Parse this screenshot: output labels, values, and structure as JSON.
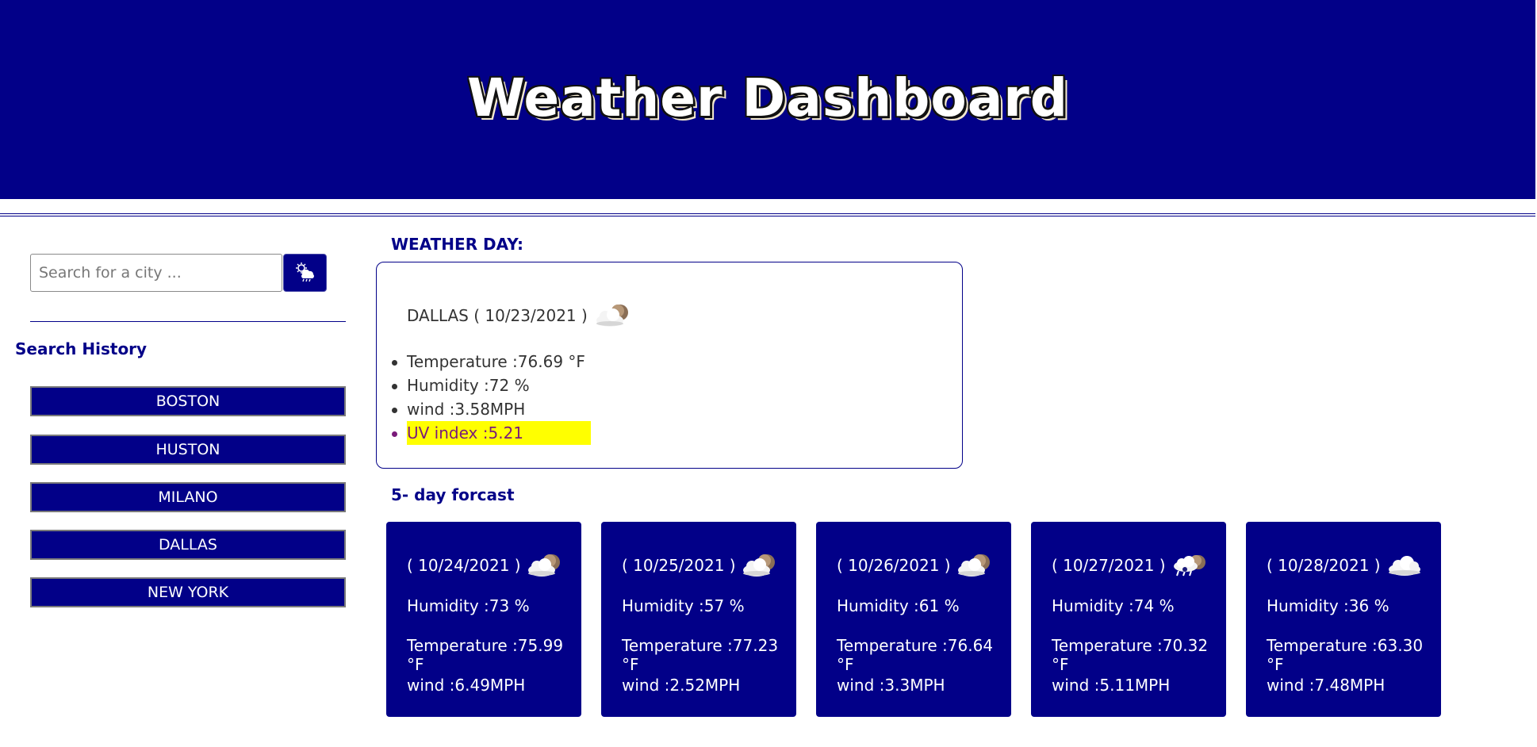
{
  "header": {
    "title": "Weather Dashboard"
  },
  "search": {
    "placeholder": "Search for a city ...",
    "button_icon": "cloud-rain-sun-icon"
  },
  "history": {
    "title": "Search History",
    "items": [
      "BOSTON",
      "HUSTON",
      "MILANO",
      "DALLAS",
      "NEW YORK"
    ]
  },
  "today": {
    "label": "WEATHER DAY:",
    "heading": "DALLAS ( 10/23/2021 )",
    "icon": "partly-cloudy-night-icon",
    "temperature": "Temperature :76.69 °F",
    "humidity": "Humidity :72 %",
    "wind": "wind :3.58MPH",
    "uv": "UV index :5.21",
    "uv_color": "#ffff00"
  },
  "forecast": {
    "label": "5- day forcast",
    "days": [
      {
        "date": "( 10/24/2021 )",
        "icon": "partly-cloudy-night-icon",
        "humidity": "Humidity :73 %",
        "temperature": "Temperature :75.99 °F",
        "wind": "wind :6.49MPH"
      },
      {
        "date": "( 10/25/2021 )",
        "icon": "partly-cloudy-night-icon",
        "humidity": "Humidity :57 %",
        "temperature": "Temperature :77.23 °F",
        "wind": "wind :2.52MPH"
      },
      {
        "date": "( 10/26/2021 )",
        "icon": "partly-cloudy-night-icon",
        "humidity": "Humidity :61 %",
        "temperature": "Temperature :76.64 °F",
        "wind": "wind :3.3MPH"
      },
      {
        "date": "( 10/27/2021 )",
        "icon": "rain-cloud-night-icon",
        "humidity": "Humidity :74 %",
        "temperature": "Temperature :70.32 °F",
        "wind": "wind :5.11MPH"
      },
      {
        "date": "( 10/28/2021 )",
        "icon": "cloud-icon",
        "humidity": "Humidity :36 %",
        "temperature": "Temperature :63.30 °F",
        "wind": "wind :7.48MPH"
      }
    ]
  },
  "colors": {
    "primary": "#020088",
    "highlight": "#ffff00",
    "uv_text": "#7a1a7a"
  }
}
